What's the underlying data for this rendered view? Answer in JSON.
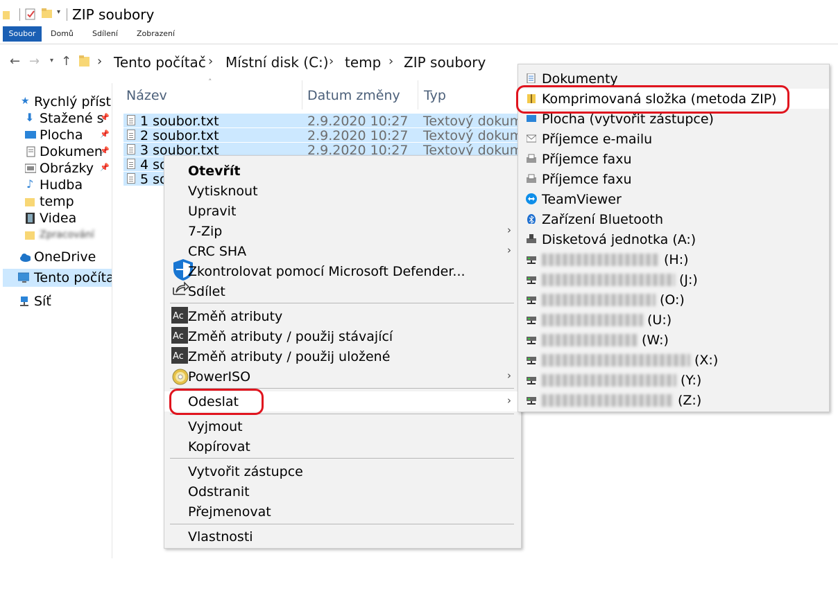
{
  "window": {
    "title": "ZIP soubory"
  },
  "ribbon": {
    "tabs": [
      "Soubor",
      "Domů",
      "Sdílení",
      "Zobrazení"
    ]
  },
  "address": {
    "crumbs": [
      "Tento počítač",
      "Místní disk (C:)",
      "temp",
      "ZIP soubory"
    ]
  },
  "nav": {
    "items": [
      {
        "label": "Rychlý přístup",
        "icon": "star-icon",
        "pinned": false
      },
      {
        "label": "Stažené s",
        "icon": "download-icon",
        "pinned": true
      },
      {
        "label": "Plocha",
        "icon": "desktop-icon",
        "pinned": true
      },
      {
        "label": "Dokumen",
        "icon": "documents-icon",
        "pinned": true
      },
      {
        "label": "Obrázky",
        "icon": "pictures-icon",
        "pinned": true
      },
      {
        "label": "Hudba",
        "icon": "music-icon",
        "pinned": false
      },
      {
        "label": "temp",
        "icon": "folder-icon",
        "pinned": false
      },
      {
        "label": "Videa",
        "icon": "video-icon",
        "pinned": false
      },
      {
        "label": "Zpracování",
        "icon": "folder-icon",
        "pinned": false
      },
      {
        "label": "OneDrive",
        "icon": "cloud-icon",
        "pinned": false
      },
      {
        "label": "Tento počítač",
        "icon": "computer-icon",
        "pinned": false
      },
      {
        "label": "Síť",
        "icon": "network-icon",
        "pinned": false
      }
    ]
  },
  "columns": {
    "name": "Název",
    "date": "Datum změny",
    "type": "Typ"
  },
  "files": [
    {
      "name": "1 soubor.txt",
      "date": "2.9.2020 10:27",
      "type": "Textový dokum"
    },
    {
      "name": "2 soubor.txt",
      "date": "2.9.2020 10:27",
      "type": "Textový dokum"
    },
    {
      "name": "3 soubor.txt",
      "date": "2.9.2020 10:27",
      "type": "Textový dokum"
    },
    {
      "name": "4 so",
      "date": "",
      "type": ""
    },
    {
      "name": "5 so",
      "date": "",
      "type": ""
    }
  ],
  "context_menu": {
    "open": "Otevřít",
    "print": "Vytisknout",
    "edit": "Upravit",
    "zip7": "7-Zip",
    "crc": "CRC SHA",
    "defender": "Zkontrolovat pomocí Microsoft Defender...",
    "share": "Sdílet",
    "attr1": "Změň atributy",
    "attr2": "Změň atributy / použij stávající",
    "attr3": "Změň atributy / použij uložené",
    "poweriso": "PowerISO",
    "sendto": "Odeslat",
    "cut": "Vyjmout",
    "copy": "Kopírovat",
    "shortcut": "Vytvořit zástupce",
    "delete": "Odstranit",
    "rename": "Přejmenovat",
    "properties": "Vlastnosti"
  },
  "sendto_menu": {
    "items": [
      {
        "label": "Dokumenty",
        "icon": "documents-icon",
        "obscured": false
      },
      {
        "label": "Komprimovaná složka (metoda ZIP)",
        "icon": "zip-folder-icon",
        "obscured": false
      },
      {
        "label": "Plocha (vytvořit zástupce)",
        "icon": "desktop-icon",
        "obscured": false
      },
      {
        "label": "Příjemce e-mailu",
        "icon": "mail-icon",
        "obscured": false
      },
      {
        "label": "Příjemce faxu",
        "icon": "fax-icon",
        "obscured": false
      },
      {
        "label": "Příjemce faxu",
        "icon": "fax-icon",
        "obscured": false
      },
      {
        "label": "TeamViewer",
        "icon": "teamviewer-icon",
        "obscured": false
      },
      {
        "label": "Zařízení Bluetooth",
        "icon": "bluetooth-icon",
        "obscured": false
      },
      {
        "label": "Disketová jednotka (A:)",
        "icon": "floppy-icon",
        "obscured": false
      },
      {
        "label": "(H:)",
        "icon": "network-drive-icon",
        "obscured": true
      },
      {
        "label": "(J:)",
        "icon": "network-drive-icon",
        "obscured": true
      },
      {
        "label": "(O:)",
        "icon": "network-drive-icon",
        "obscured": true
      },
      {
        "label": "(U:)",
        "icon": "network-drive-icon",
        "obscured": true
      },
      {
        "label": "(W:)",
        "icon": "network-drive-icon",
        "obscured": true
      },
      {
        "label": "(X:)",
        "icon": "network-drive-icon",
        "obscured": true
      },
      {
        "label": "(Y:)",
        "icon": "network-drive-icon",
        "obscured": true
      },
      {
        "label": "(Z:)",
        "icon": "network-drive-icon",
        "obscured": true
      }
    ]
  },
  "colors": {
    "selection": "#cce8ff",
    "accent": "#1a5fb4",
    "annotation": "#e0141e"
  }
}
